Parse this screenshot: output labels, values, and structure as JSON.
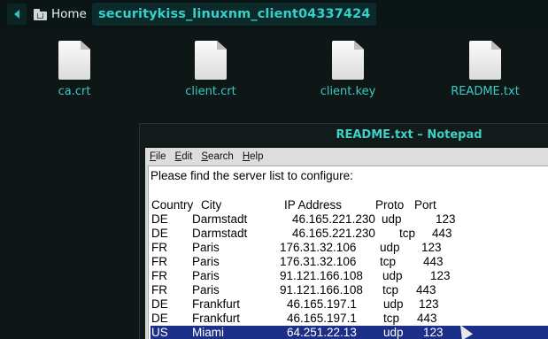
{
  "file_manager": {
    "breadcrumb_home": "Home",
    "breadcrumb_current": "securitykiss_linuxnm_client04337424"
  },
  "files": [
    {
      "name": "ca.crt"
    },
    {
      "name": "client.crt"
    },
    {
      "name": "client.key"
    },
    {
      "name": "README.txt"
    }
  ],
  "notepad": {
    "title": "README.txt – Notepad",
    "menu": [
      "File",
      "Edit",
      "Search",
      "Help"
    ],
    "intro": "Please find the server list to configure:",
    "headers": {
      "country": "Country",
      "city": "City",
      "ip": "IP Address",
      "proto": "Proto",
      "port": "Port"
    },
    "rows": [
      {
        "country": "DE",
        "city": "Darmstadt",
        "ip": "46.165.221.230",
        "proto": "udp",
        "port": "123"
      },
      {
        "country": "DE",
        "city": "Darmstadt",
        "ip": "46.165.221.230",
        "proto": "tcp",
        "port": "443"
      },
      {
        "country": "FR",
        "city": "Paris",
        "ip": "176.31.32.106",
        "proto": "udp",
        "port": "123"
      },
      {
        "country": "FR",
        "city": "Paris",
        "ip": "176.31.32.106",
        "proto": "tcp",
        "port": "443"
      },
      {
        "country": "FR",
        "city": "Paris",
        "ip": "91.121.166.108",
        "proto": "udp",
        "port": "123"
      },
      {
        "country": "FR",
        "city": "Paris",
        "ip": "91.121.166.108",
        "proto": "tcp",
        "port": "443"
      },
      {
        "country": "DE",
        "city": "Frankfurt",
        "ip": "46.165.197.1",
        "proto": "udp",
        "port": "123"
      },
      {
        "country": "DE",
        "city": "Frankfurt",
        "ip": "46.165.197.1",
        "proto": "tcp",
        "port": "443"
      },
      {
        "country": "US",
        "city": "Miami",
        "ip": "64.251.22.13",
        "proto": "udp",
        "port": "123"
      }
    ],
    "selected_row": 8
  },
  "colors": {
    "accent": "#36d0c8",
    "desktop_bg": "#0e1616",
    "selection": "#1c2f88"
  }
}
